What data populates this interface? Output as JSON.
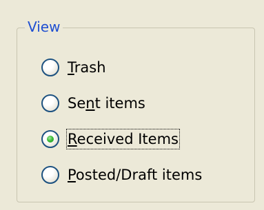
{
  "groupbox": {
    "title": "View"
  },
  "options": [
    {
      "label_pre": "",
      "mnemonic": "T",
      "label_post": "rash",
      "selected": false
    },
    {
      "label_pre": "Se",
      "mnemonic": "n",
      "label_post": "t items",
      "selected": false
    },
    {
      "label_pre": "",
      "mnemonic": "R",
      "label_post": "eceived Items",
      "selected": true
    },
    {
      "label_pre": "",
      "mnemonic": "P",
      "label_post": "osted/Draft items",
      "selected": false
    }
  ],
  "colors": {
    "legend": "#1f4fd1",
    "background": "#ece9d8",
    "radio_border": "#1c5180",
    "radio_dot": "#3fbf3a"
  }
}
